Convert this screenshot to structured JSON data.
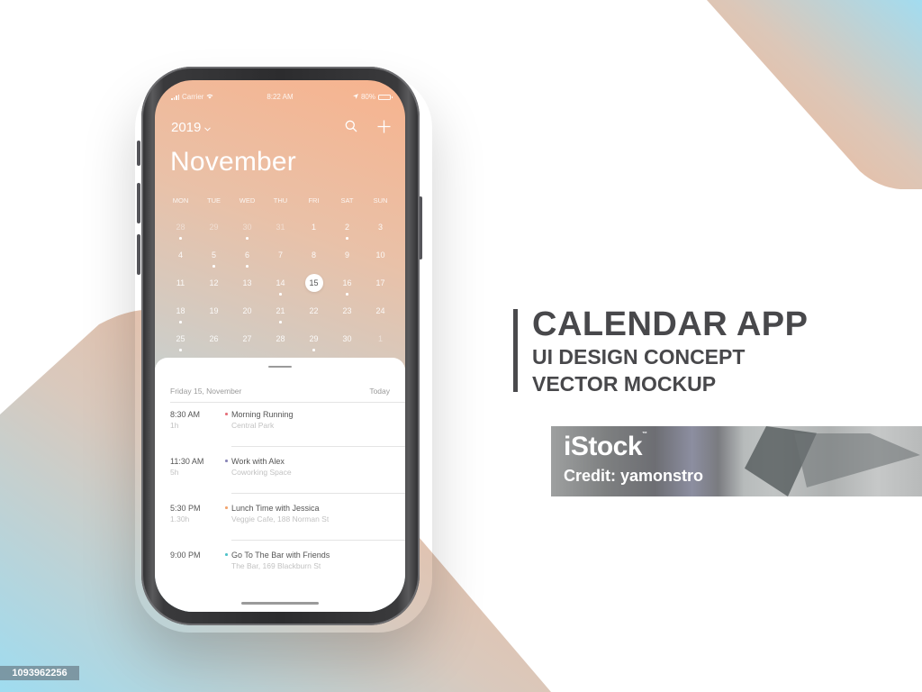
{
  "status_bar": {
    "carrier": "Carrier",
    "time": "8:22 AM",
    "battery": "80%",
    "battery_level": 0.8
  },
  "header": {
    "year": "2019",
    "year_chevron": "⌄",
    "month": "November",
    "search_icon": "search-icon",
    "add_icon": "plus-icon"
  },
  "weekdays": [
    "MON",
    "TUE",
    "WED",
    "THU",
    "FRI",
    "SAT",
    "SUN"
  ],
  "calendar_days": [
    {
      "n": "28",
      "muted": true,
      "dot": true
    },
    {
      "n": "29",
      "muted": true,
      "dot": false
    },
    {
      "n": "30",
      "muted": true,
      "dot": true
    },
    {
      "n": "31",
      "muted": true,
      "dot": false
    },
    {
      "n": "1",
      "muted": false,
      "dot": false
    },
    {
      "n": "2",
      "muted": false,
      "dot": true
    },
    {
      "n": "3",
      "muted": false,
      "dot": false
    },
    {
      "n": "4",
      "muted": false,
      "dot": false
    },
    {
      "n": "5",
      "muted": false,
      "dot": true
    },
    {
      "n": "6",
      "muted": false,
      "dot": true
    },
    {
      "n": "7",
      "muted": false,
      "dot": false
    },
    {
      "n": "8",
      "muted": false,
      "dot": false
    },
    {
      "n": "9",
      "muted": false,
      "dot": false
    },
    {
      "n": "10",
      "muted": false,
      "dot": false
    },
    {
      "n": "11",
      "muted": false,
      "dot": false
    },
    {
      "n": "12",
      "muted": false,
      "dot": false
    },
    {
      "n": "13",
      "muted": false,
      "dot": false
    },
    {
      "n": "14",
      "muted": false,
      "dot": true
    },
    {
      "n": "15",
      "muted": false,
      "dot": false,
      "selected": true
    },
    {
      "n": "16",
      "muted": false,
      "dot": true
    },
    {
      "n": "17",
      "muted": false,
      "dot": false
    },
    {
      "n": "18",
      "muted": false,
      "dot": true
    },
    {
      "n": "19",
      "muted": false,
      "dot": false
    },
    {
      "n": "20",
      "muted": false,
      "dot": false
    },
    {
      "n": "21",
      "muted": false,
      "dot": true
    },
    {
      "n": "22",
      "muted": false,
      "dot": false
    },
    {
      "n": "23",
      "muted": false,
      "dot": false
    },
    {
      "n": "24",
      "muted": false,
      "dot": false
    },
    {
      "n": "25",
      "muted": false,
      "dot": true
    },
    {
      "n": "26",
      "muted": false,
      "dot": false
    },
    {
      "n": "27",
      "muted": false,
      "dot": false
    },
    {
      "n": "28",
      "muted": false,
      "dot": false
    },
    {
      "n": "29",
      "muted": false,
      "dot": true
    },
    {
      "n": "30",
      "muted": false,
      "dot": false
    },
    {
      "n": "1",
      "muted": true,
      "dot": false
    }
  ],
  "agenda": {
    "date_label": "Friday 15, November",
    "today_label": "Today",
    "events": [
      {
        "time": "8:30 AM",
        "duration": "1h",
        "title": "Morning Running",
        "location": "Central Park",
        "color": "#e5707a"
      },
      {
        "time": "11:30 AM",
        "duration": "5h",
        "title": "Work with Alex",
        "location": "Coworking Space",
        "color": "#8a86b8"
      },
      {
        "time": "5:30 PM",
        "duration": "1.30h",
        "title": "Lunch Time with Jessica",
        "location": "Veggie Cafe, 188 Norman St",
        "color": "#f2a46e"
      },
      {
        "time": "9:00 PM",
        "duration": "",
        "title": "Go To The Bar with Friends",
        "location": "The Bar, 169 Blackburn St",
        "color": "#4fc2c9"
      }
    ]
  },
  "promo": {
    "title": "CALENDAR APP",
    "line2": "UI DESIGN CONCEPT",
    "line3": "VECTOR MOCKUP"
  },
  "watermark": {
    "brand": "iStock",
    "tm": "™",
    "credit": "Credit: yamonstro"
  },
  "image_id": "1093962256",
  "colors": {
    "peach": "#f7b38e",
    "sky": "#a6dbee",
    "text_dark": "#48484b"
  }
}
